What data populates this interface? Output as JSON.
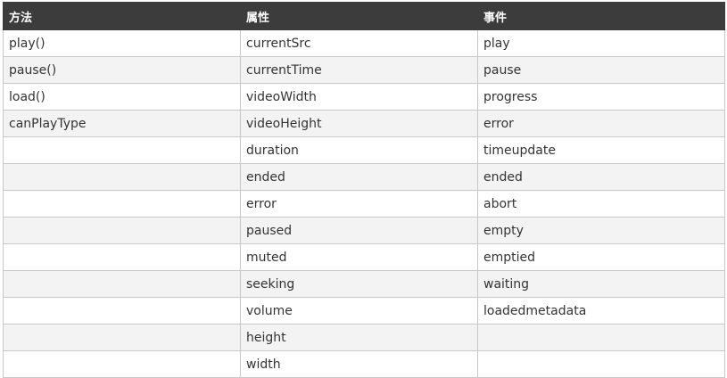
{
  "table": {
    "headers": [
      "方法",
      "属性",
      "事件"
    ],
    "rows": [
      [
        "play()",
        "currentSrc",
        "play"
      ],
      [
        "pause()",
        "currentTime",
        "pause"
      ],
      [
        "load()",
        "videoWidth",
        "progress"
      ],
      [
        "canPlayType",
        "videoHeight",
        "error"
      ],
      [
        "",
        "duration",
        "timeupdate"
      ],
      [
        "",
        "ended",
        "ended"
      ],
      [
        "",
        "error",
        "abort"
      ],
      [
        "",
        "paused",
        "empty"
      ],
      [
        "",
        "muted",
        "emptied"
      ],
      [
        "",
        "seeking",
        "waiting"
      ],
      [
        "",
        "volume",
        "loadedmetadata"
      ],
      [
        "",
        "height",
        ""
      ],
      [
        "",
        "width",
        ""
      ]
    ]
  },
  "colors": {
    "header_bg": "#3c3c3c",
    "header_text": "#ffffff",
    "row_alt_bg": "#f3f3f3",
    "border": "#c8c8c8"
  }
}
